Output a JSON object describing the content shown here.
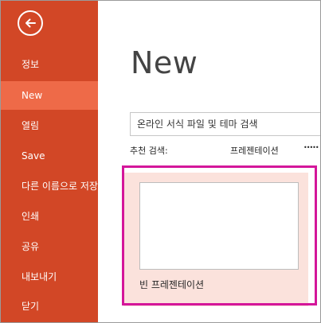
{
  "sidebar": {
    "back_icon": "back-arrow-icon",
    "items": [
      {
        "label": "정보"
      },
      {
        "label": "New"
      },
      {
        "label": "열림"
      },
      {
        "label": "Save"
      },
      {
        "label": "다른 이름으로 저장"
      },
      {
        "label": "인쇄"
      },
      {
        "label": "공유"
      },
      {
        "label": "내보내기"
      },
      {
        "label": "닫기"
      }
    ],
    "active_index": 1,
    "background": "#d24726",
    "active_background": "#ee6a48"
  },
  "main": {
    "title": "New",
    "search": {
      "placeholder": "온라인 서식 파일 및 테마 검색",
      "value": "",
      "button_icon": "search-icon"
    },
    "suggested": {
      "label": "추천 검색:",
      "links": [
        "프레젠테이션"
      ]
    },
    "templates": [
      {
        "label": "빈 프레젠테이션"
      }
    ]
  },
  "highlight_color": "#d4169a"
}
